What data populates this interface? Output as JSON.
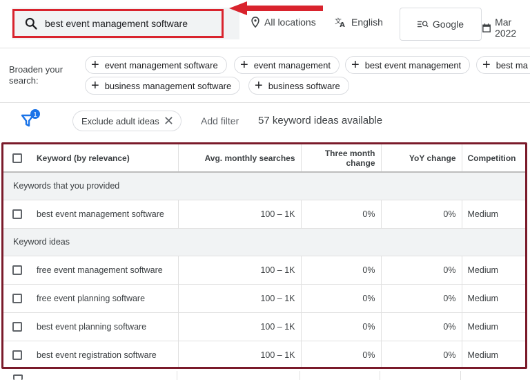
{
  "search": {
    "query": "best event management software",
    "icon": "search-icon"
  },
  "toolbar": {
    "location": "All locations",
    "location_icon": "location-pin-icon",
    "language": "English",
    "language_icon": "translate-icon",
    "network": "Google",
    "network_icon": "search-network-icon",
    "date": "Mar 2022",
    "date_icon": "calendar-icon"
  },
  "annotation": {
    "arrow_color": "#d9232d",
    "highlight_color": "#7a1a2a"
  },
  "broaden": {
    "label": "Broaden your search:",
    "chips": [
      "event management software",
      "event management",
      "best event management",
      "best ma",
      "business management software",
      "business software"
    ]
  },
  "filters": {
    "badge_count": "1",
    "exclude_chip": "Exclude adult ideas",
    "add_filter": "Add filter",
    "ideas_available": "57 keyword ideas available"
  },
  "table": {
    "columns": {
      "keyword": "Keyword (by relevance)",
      "avg": "Avg. monthly searches",
      "three_month": "Three month change",
      "yoy": "YoY change",
      "competition": "Competition"
    },
    "groups": [
      {
        "label": "Keywords that you provided",
        "rows": [
          {
            "keyword": "best event management software",
            "avg": "100 – 1K",
            "three_month": "0%",
            "yoy": "0%",
            "competition": "Medium"
          }
        ]
      },
      {
        "label": "Keyword ideas",
        "rows": [
          {
            "keyword": "free event management software",
            "avg": "100 – 1K",
            "three_month": "0%",
            "yoy": "0%",
            "competition": "Medium"
          },
          {
            "keyword": "free event planning software",
            "avg": "100 – 1K",
            "three_month": "0%",
            "yoy": "0%",
            "competition": "Medium"
          },
          {
            "keyword": "best event planning software",
            "avg": "100 – 1K",
            "three_month": "0%",
            "yoy": "0%",
            "competition": "Medium"
          },
          {
            "keyword": "best event registration software",
            "avg": "100 – 1K",
            "three_month": "0%",
            "yoy": "0%",
            "competition": "Medium"
          }
        ]
      }
    ]
  }
}
